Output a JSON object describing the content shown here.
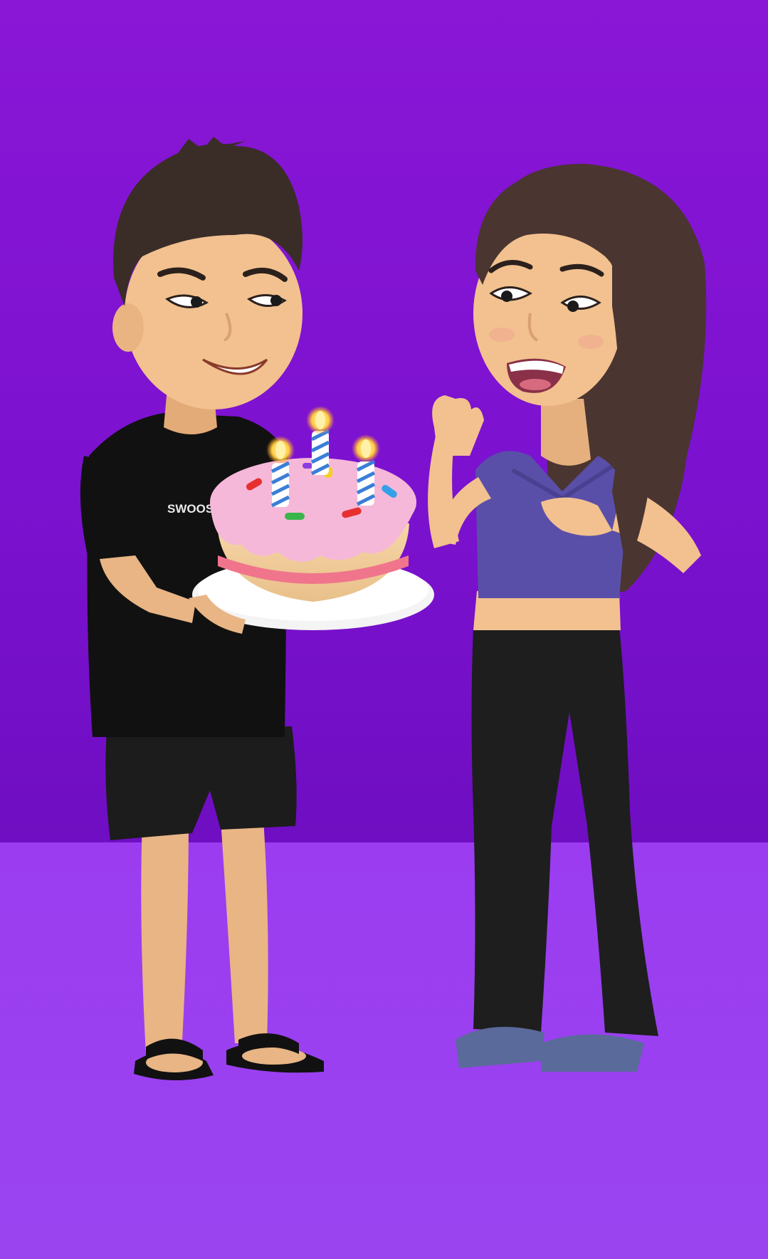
{
  "scene": {
    "description_text": "",
    "shirt_print_text": "SWOOSH",
    "colors": {
      "backdrop": "#7c12d0",
      "floor": "#9b3cf0",
      "skin": "#f2c18f",
      "hair_boy": "#3a2d28",
      "hair_girl": "#4a3530",
      "shirt_boy": "#111111",
      "shorts_boy": "#1c1c1c",
      "top_girl": "#5a4fa8",
      "pants_girl": "#1e1e1e",
      "shoes_girl": "#5a6a9a",
      "cake_icing": "#f6b8d8",
      "plate": "#ffffff"
    },
    "candles": 3
  }
}
